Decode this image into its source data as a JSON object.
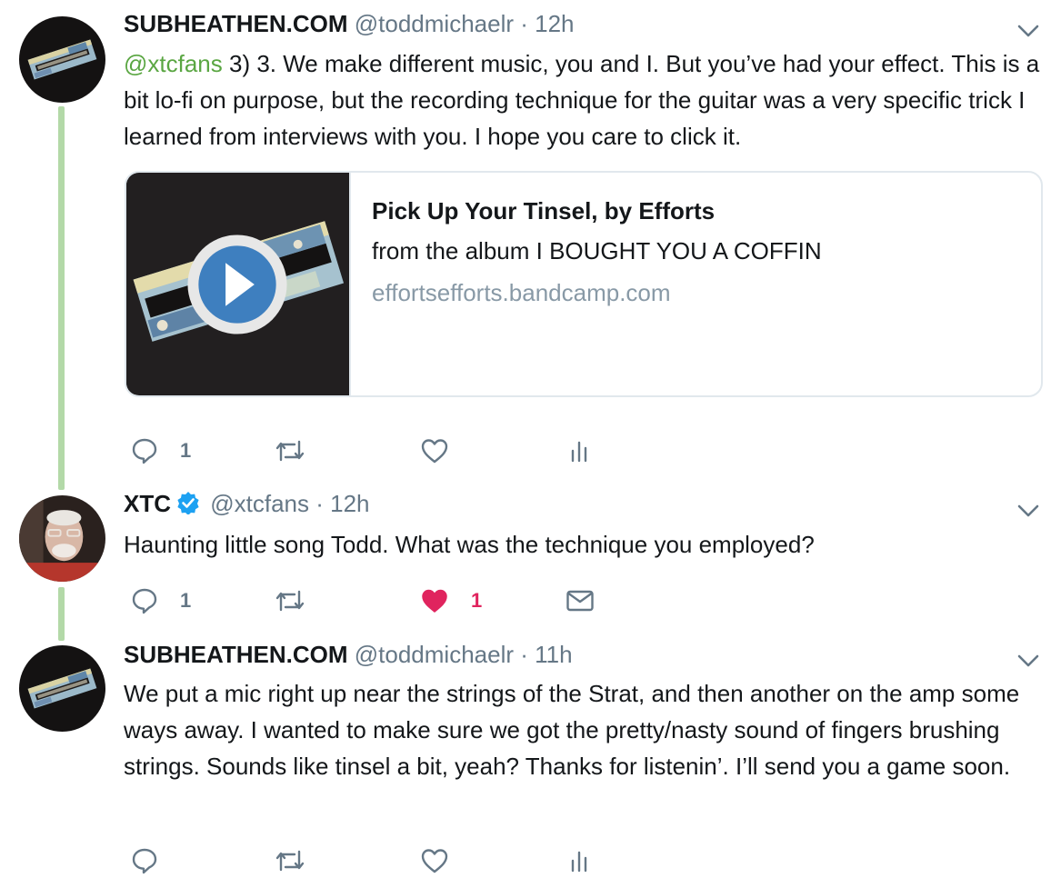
{
  "tweets": [
    {
      "name": "SUBHEATHEN.COM",
      "handle": "@toddmichaelr",
      "separator": " · ",
      "time": "12h",
      "mention": "@xtcfans",
      "text": " 3) 3. We make different music, you and I. But you’ve had your effect. This is a bit lo-fi on purpose, but the recording technique for the guitar was a very specific trick I learned from interviews with you. I hope you care to click it.",
      "card": {
        "title": "Pick Up Your Tinsel, by Efforts",
        "description": "from the album I BOUGHT YOU A COFFIN",
        "url": "effortsefforts.bandcamp.com",
        "thumbnail_icon": "album-art-play-icon"
      },
      "actions": {
        "reply_count": "1",
        "retweet_count": "",
        "like_count": "",
        "fourth_icon": "analytics-icon"
      }
    },
    {
      "name": "XTC",
      "verified": true,
      "handle": "@xtcfans",
      "separator": " · ",
      "time": "12h",
      "text": "Haunting little song Todd. What was the technique you employed?",
      "actions": {
        "reply_count": "1",
        "retweet_count": "",
        "like_count": "1",
        "liked": true,
        "fourth_icon": "direct-message-icon"
      }
    },
    {
      "name": "SUBHEATHEN.COM",
      "handle": "@toddmichaelr",
      "separator": " · ",
      "time": "11h",
      "text": "We put a mic right up near the strings of the Strat, and then another on the amp some ways away. I wanted to make sure we got the pretty/nasty sound of fingers brushing strings. Sounds like tinsel a bit, yeah? Thanks for listenin’. I’ll send you a game soon.",
      "actions": {
        "reply_count": "",
        "retweet_count": "",
        "like_count": "",
        "fourth_icon": "analytics-icon"
      }
    }
  ],
  "colors": {
    "thread_line": "#b3d9a8",
    "mention": "#5aa642",
    "like": "#e0245e",
    "muted": "#657786",
    "verified": "#1da1f2"
  }
}
